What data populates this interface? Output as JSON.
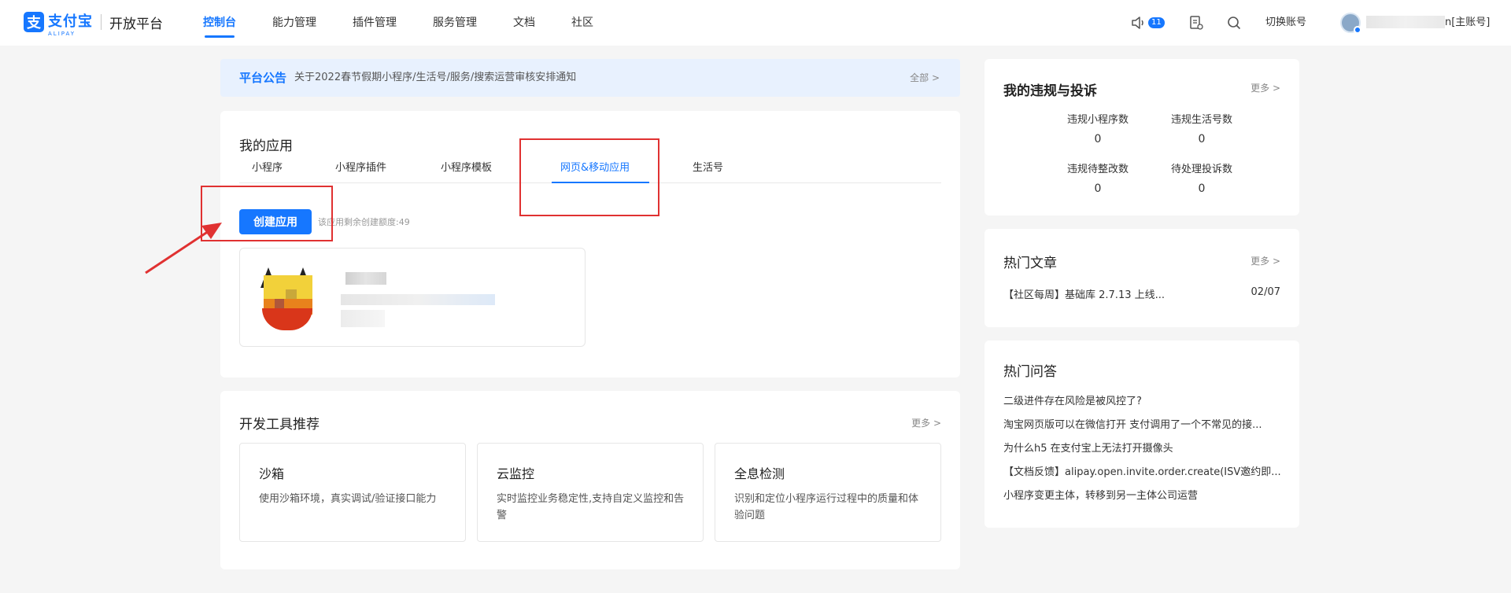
{
  "header": {
    "logo_glyph": "支",
    "logo_cn": "支付宝",
    "logo_en": "ALIPAY",
    "platform": "开放平台",
    "nav": [
      {
        "label": "控制台",
        "active": true
      },
      {
        "label": "能力管理"
      },
      {
        "label": "插件管理"
      },
      {
        "label": "服务管理"
      },
      {
        "label": "文档"
      },
      {
        "label": "社区"
      }
    ],
    "message_count": "11",
    "switch_account": "切换账号",
    "account_suffix": "n[主账号]",
    "icons": [
      "speaker-icon",
      "document-icon",
      "search-icon"
    ]
  },
  "notice": {
    "title": "平台公告",
    "text": "关于2022春节假期小程序/生活号/服务/搜索运营审核安排通知",
    "all_link": "全部 >"
  },
  "my_apps": {
    "title": "我的应用",
    "tabs": [
      "小程序",
      "小程序插件",
      "小程序模板",
      "网页&移动应用",
      "生活号"
    ],
    "active_tab": "网页&移动应用",
    "create_button": "创建应用",
    "quota_text": "该应用剩余创建额度:49"
  },
  "dev_tools": {
    "title": "开发工具推荐",
    "more": "更多 >",
    "items": [
      {
        "name": "沙箱",
        "desc": "使用沙箱环境，真实调试/验证接口能力"
      },
      {
        "name": "云监控",
        "desc": "实时监控业务稳定性,支持自定义监控和告警"
      },
      {
        "name": "全息检测",
        "desc": "识别和定位小程序运行过程中的质量和体验问题"
      }
    ]
  },
  "violations": {
    "title": "我的违规与投诉",
    "more": "更多 >",
    "stats": [
      {
        "label": "违规小程序数",
        "value": "0"
      },
      {
        "label": "违规生活号数",
        "value": "0"
      },
      {
        "label": "违规待整改数",
        "value": "0"
      },
      {
        "label": "待处理投诉数",
        "value": "0"
      }
    ]
  },
  "hot_articles": {
    "title": "热门文章",
    "more": "更多 >",
    "items": [
      {
        "text": "【社区每周】基础库 2.7.13 上线...",
        "date": "02/07"
      }
    ]
  },
  "hot_qa": {
    "title": "热门问答",
    "items": [
      "二级进件存在风险是被风控了?",
      "淘宝网页版可以在微信打开 支付调用了一个不常见的接...",
      "为什么h5 在支付宝上无法打开摄像头",
      "【文档反馈】alipay.open.invite.order.create(ISV邀约即...",
      "小程序变更主体，转移到另一主体公司运营"
    ]
  },
  "colors": {
    "brand": "#1677ff",
    "annotation": "#e03131",
    "background": "#f5f5f5"
  }
}
